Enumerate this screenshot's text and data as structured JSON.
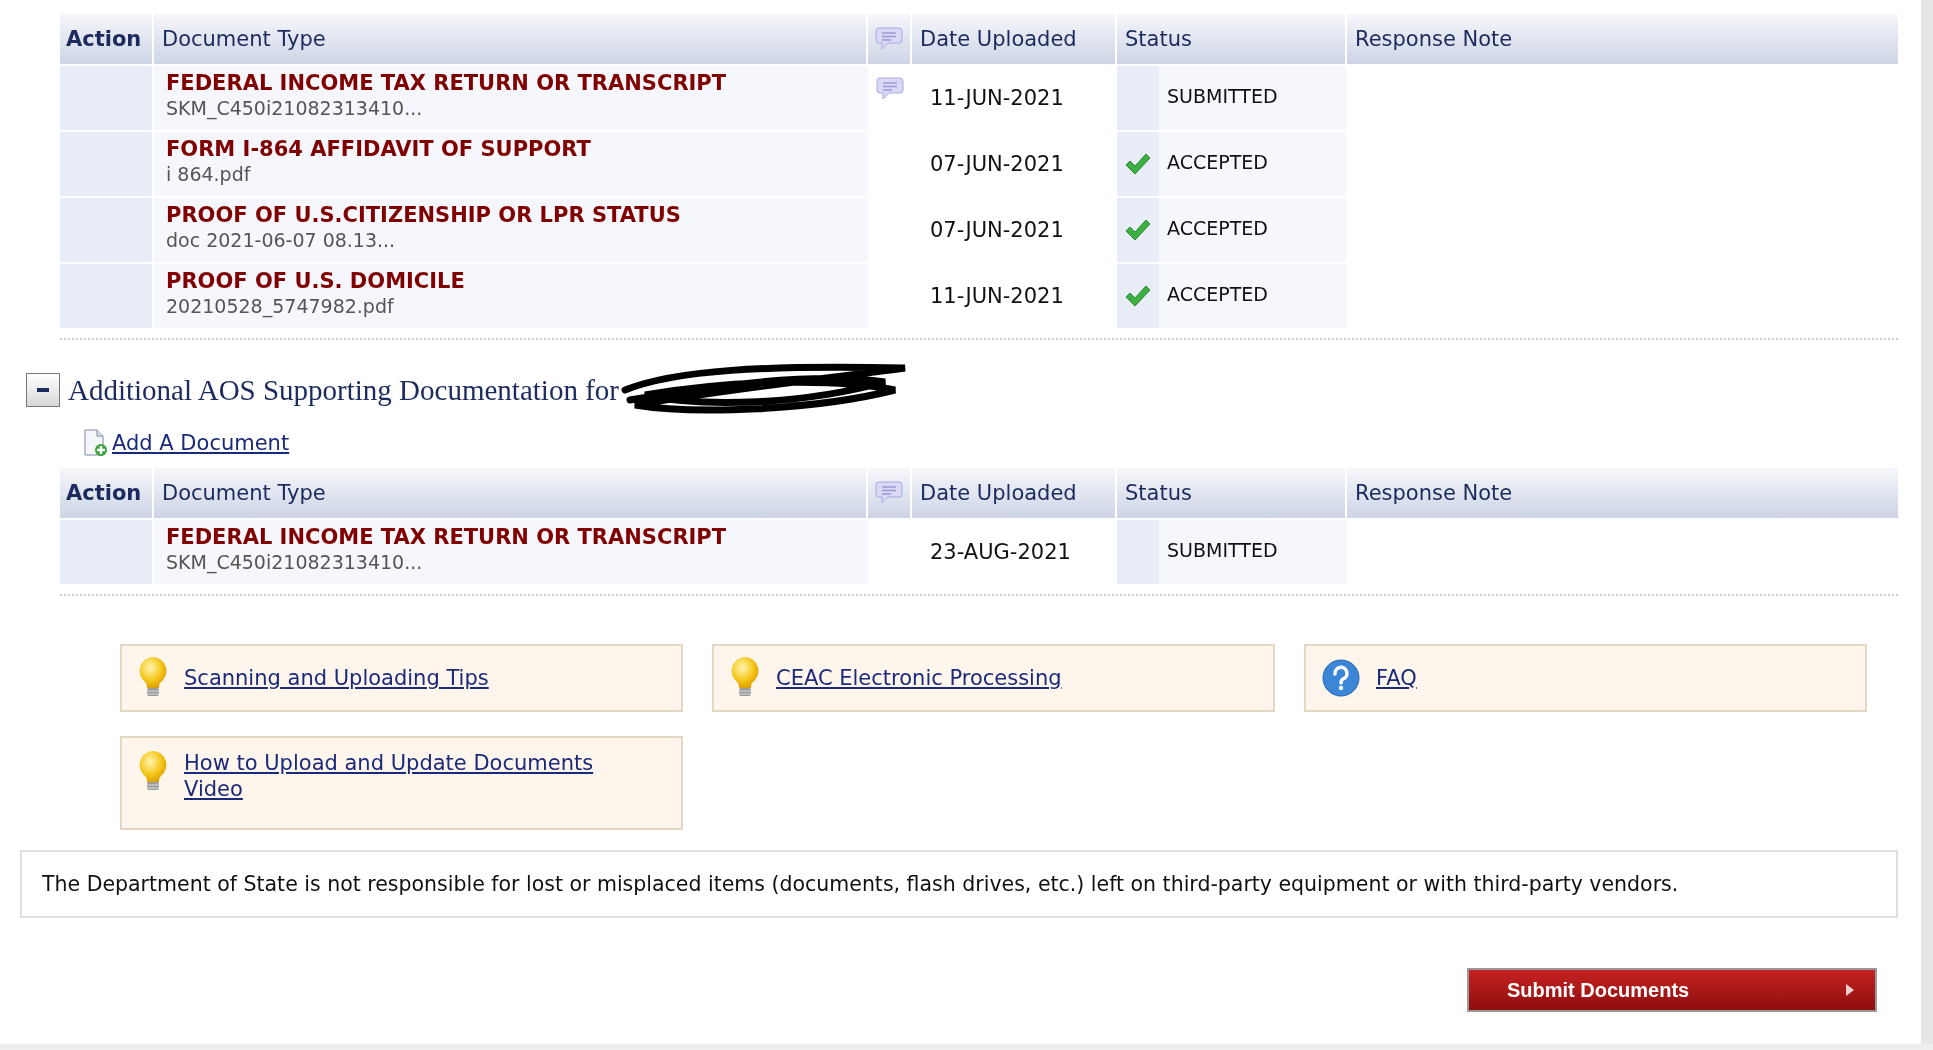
{
  "table_1": {
    "columns": [
      "Action",
      "Document Type",
      "Date Uploaded",
      "Status",
      "Response Note"
    ],
    "rows": [
      {
        "document_type": "FEDERAL INCOME TAX RETURN OR TRANSCRIPT",
        "file": "SKM_C450i21082313410...",
        "comment": true,
        "date_uploaded": "11-JUN-2021",
        "status": "SUBMITTED",
        "accepted": false
      },
      {
        "document_type": "FORM I-864 AFFIDAVIT OF SUPPORT",
        "file": "i 864.pdf",
        "comment": false,
        "date_uploaded": "07-JUN-2021",
        "status": "ACCEPTED",
        "accepted": true
      },
      {
        "document_type": "PROOF OF U.S.CITIZENSHIP OR LPR STATUS",
        "file": "doc 2021-06-07 08.13...",
        "comment": false,
        "date_uploaded": "07-JUN-2021",
        "status": "ACCEPTED",
        "accepted": true
      },
      {
        "document_type": "PROOF OF U.S. DOMICILE",
        "file": "20210528_5747982.pdf",
        "comment": false,
        "date_uploaded": "11-JUN-2021",
        "status": "ACCEPTED",
        "accepted": true
      }
    ]
  },
  "section": {
    "title": "Additional AOS Supporting Documentation for",
    "expanded": true,
    "add_link": "Add A Document"
  },
  "table_2": {
    "columns": [
      "Action",
      "Document Type",
      "Date Uploaded",
      "Status",
      "Response Note"
    ],
    "rows": [
      {
        "document_type": "FEDERAL INCOME TAX RETURN OR TRANSCRIPT",
        "file": "SKM_C450i21082313410...",
        "comment": false,
        "date_uploaded": "23-AUG-2021",
        "status": "SUBMITTED",
        "accepted": false
      }
    ]
  },
  "help_links": [
    {
      "label": "Scanning and Uploading Tips",
      "kind": "tip"
    },
    {
      "label": "CEAC Electronic Processing",
      "kind": "tip"
    },
    {
      "label": "FAQ",
      "kind": "faq"
    },
    {
      "label": "How to Upload and Update Documents Video",
      "kind": "tip"
    }
  ],
  "disclaimer": "The Department of State is not responsible for lost or misplaced items (documents, flash drives, etc.) left on third-party equipment or with third-party vendors.",
  "submit_button": "Submit Documents"
}
